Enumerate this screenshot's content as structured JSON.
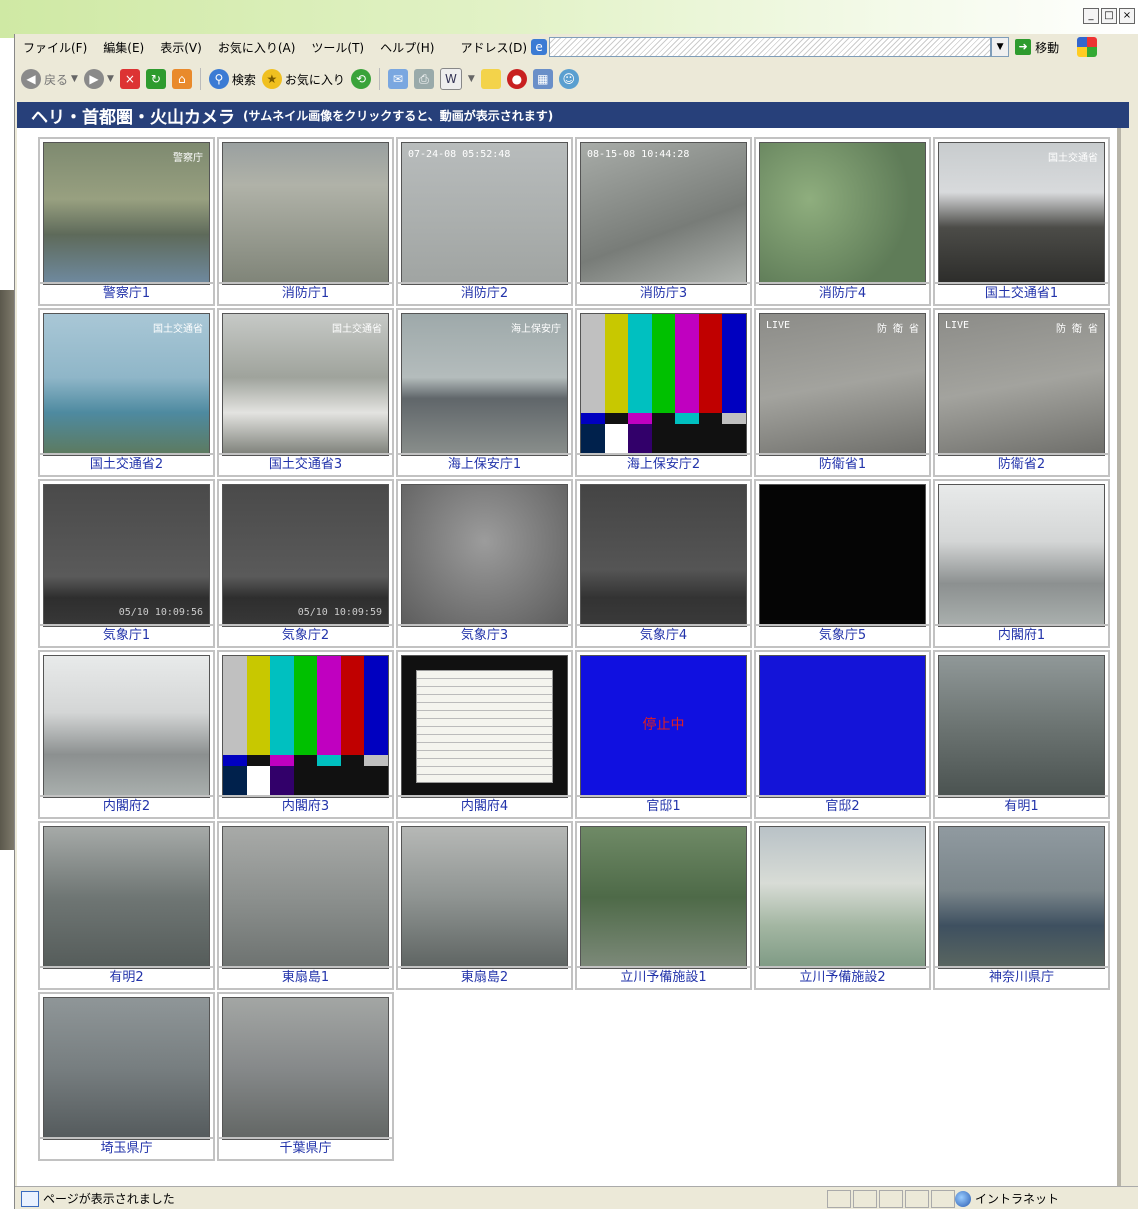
{
  "window": {
    "menu": [
      "ファイル(F)",
      "編集(E)",
      "表示(V)",
      "お気に入り(A)",
      "ツール(T)",
      "ヘルプ(H)"
    ],
    "address_label": "アドレス(D)",
    "go_label": "移動"
  },
  "toolbar": {
    "back": "戻る",
    "search": "検索",
    "favorites": "お気に入り"
  },
  "page": {
    "title": "ヘリ・首都圏・火山カメラ",
    "subtitle": "(サムネイル画像をクリックすると、動画が表示されます)"
  },
  "cameras": [
    {
      "label": "警察庁1",
      "kind": "aerial-plant",
      "overlay_tr": "警察庁"
    },
    {
      "label": "消防庁1",
      "kind": "aerial-city"
    },
    {
      "label": "消防庁2",
      "kind": "haze-map",
      "overlay_tl": "07-24-08 05:52:48"
    },
    {
      "label": "消防庁3",
      "kind": "haze-map2",
      "overlay_tl": "08-15-08 10:44:28"
    },
    {
      "label": "消防庁4",
      "kind": "forest"
    },
    {
      "label": "国土交通省1",
      "kind": "mountain",
      "overlay_tr": "国土交通省"
    },
    {
      "label": "国土交通省2",
      "kind": "coast",
      "overlay_tr": "国土交通省"
    },
    {
      "label": "国土交通省3",
      "kind": "road",
      "overlay_tr": "国土交通省"
    },
    {
      "label": "海上保安庁1",
      "kind": "sea",
      "overlay_tr": "海上保安庁"
    },
    {
      "label": "海上保安庁2",
      "kind": "colorbars"
    },
    {
      "label": "防衛省1",
      "kind": "grey-live",
      "overlay_tl": "LIVE",
      "overlay_tr": "防 衛 省"
    },
    {
      "label": "防衛省2",
      "kind": "grey-live",
      "overlay_tl": "LIVE",
      "overlay_tr": "防 衛 省"
    },
    {
      "label": "気象庁1",
      "kind": "dark-sky",
      "overlay_br": "05/10 10:09:56"
    },
    {
      "label": "気象庁2",
      "kind": "dark-sky",
      "overlay_br": "05/10 10:09:59"
    },
    {
      "label": "気象庁3",
      "kind": "rain"
    },
    {
      "label": "気象庁4",
      "kind": "dark-sky2"
    },
    {
      "label": "気象庁5",
      "kind": "black"
    },
    {
      "label": "内閣府1",
      "kind": "city-bright"
    },
    {
      "label": "内閣府2",
      "kind": "city-bright"
    },
    {
      "label": "内閣府3",
      "kind": "colorbars"
    },
    {
      "label": "内閣府4",
      "kind": "document"
    },
    {
      "label": "官邸1",
      "kind": "blue-stop",
      "overlay_center": "停止中"
    },
    {
      "label": "官邸2",
      "kind": "blue"
    },
    {
      "label": "有明1",
      "kind": "city-gray"
    },
    {
      "label": "有明2",
      "kind": "highway"
    },
    {
      "label": "東扇島1",
      "kind": "city-haze"
    },
    {
      "label": "東扇島2",
      "kind": "port"
    },
    {
      "label": "立川予備施設1",
      "kind": "trees"
    },
    {
      "label": "立川予備施設2",
      "kind": "snowfield"
    },
    {
      "label": "神奈川県庁",
      "kind": "harbor"
    },
    {
      "label": "埼玉県庁",
      "kind": "city-gray2"
    },
    {
      "label": "千葉県庁",
      "kind": "city-wide"
    }
  ],
  "colors": {
    "header_bg": "#27407a",
    "caption_text": "#2233aa",
    "colorbars": [
      "#c0c0c0",
      "#c8c800",
      "#00c0c0",
      "#00c000",
      "#c000c0",
      "#c00000",
      "#0000c0"
    ],
    "stop_blue": "#1010e0"
  },
  "status": {
    "text": "ページが表示されました",
    "zone": "イントラネット"
  }
}
